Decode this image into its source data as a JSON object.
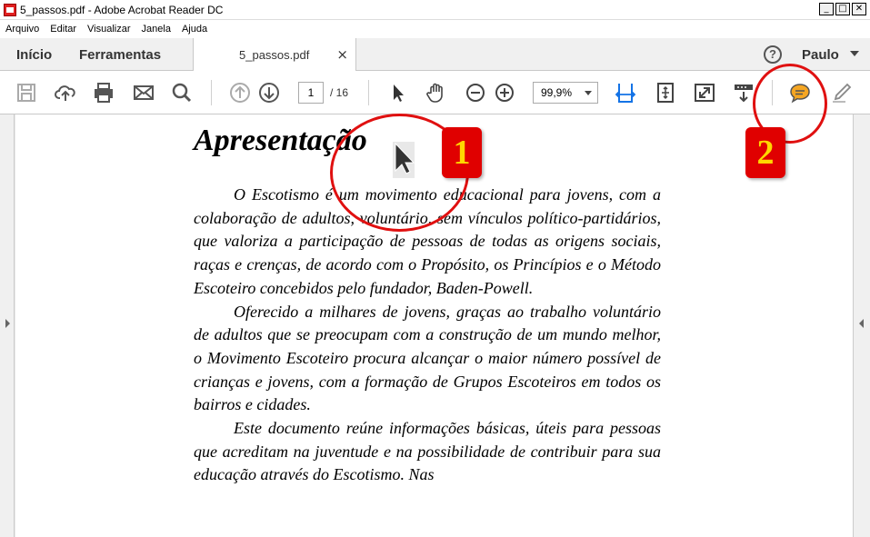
{
  "window": {
    "title": "5_passos.pdf - Adobe Acrobat Reader DC",
    "minimize": "_",
    "maximize": "□",
    "close": "✕"
  },
  "menu": [
    "Arquivo",
    "Editar",
    "Visualizar",
    "Janela",
    "Ajuda"
  ],
  "tabs": {
    "home": "Início",
    "tools": "Ferramentas",
    "document": "5_passos.pdf",
    "close": "×"
  },
  "user": {
    "help": "?",
    "name": "Paulo"
  },
  "toolbar": {
    "page_current": "1",
    "page_total": "/ 16",
    "zoom": "99,9%",
    "icons": [
      "save-icon",
      "upload-icon",
      "print-icon",
      "email-icon",
      "search-icon",
      "previous-page-icon",
      "next-page-icon",
      "select-cursor-icon",
      "hand-tool-icon",
      "zoom-out-icon",
      "zoom-in-icon",
      "fit-width-icon",
      "fit-page-icon",
      "full-screen-icon",
      "scroll-mode-icon",
      "comment-icon",
      "highlight-pen-icon"
    ]
  },
  "document": {
    "heading": "Apresentação",
    "paragraphs": [
      "O Escotismo é um movimento educacional para jovens, com a colaboração de adultos, voluntário, sem vínculos político-partidários, que valoriza a participação de pessoas de todas as origens sociais, raças e crenças, de acordo com o Propósito, os Princípios e o Método Escoteiro concebidos pelo fundador, Baden-Powell.",
      "Oferecido a milhares de jovens, graças ao trabalho voluntário de adultos que se preocupam com a construção de um mundo melhor, o Movimento Escoteiro procura alcançar o maior número possível de crianças e jovens, com a formação de Grupos Escoteiros em todos os bairros e cidades.",
      "Este documento reúne informações básicas, úteis para pessoas que acreditam na juventude e na possibilidade de contribuir para sua educação através do Escotismo. Nas"
    ]
  },
  "annotations": {
    "badge1": "1",
    "badge2": "2"
  },
  "colors": {
    "accent_blue": "#1473e6",
    "comment_orange": "#f5a623",
    "callout_red": "#e01010",
    "badge_yellow": "#ffd700"
  }
}
